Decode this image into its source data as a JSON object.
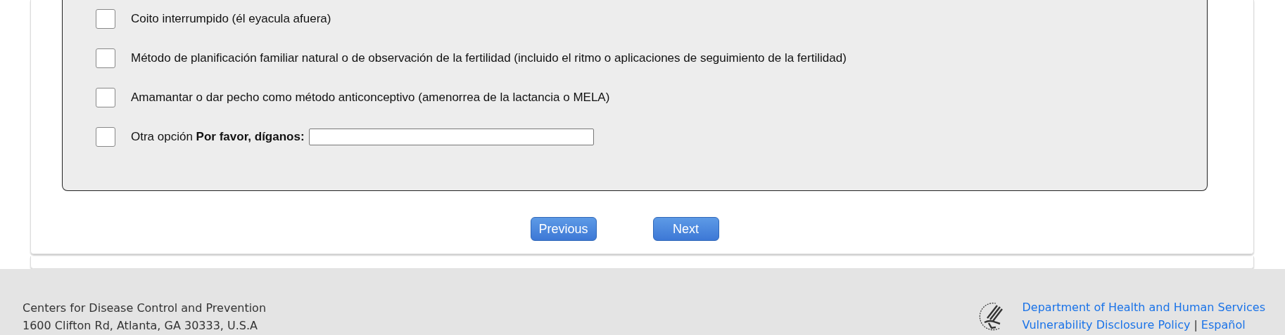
{
  "options": [
    {
      "label": "Coito interrumpido (él eyacula afuera)",
      "checked": false
    },
    {
      "label": "Método de planificación familiar natural o de observación de la fertilidad (incluido el ritmo o aplicaciones de seguimiento de la fertilidad)",
      "checked": false
    },
    {
      "label": "Amamantar o dar pecho como método anticonceptivo (amenorrea de la lactancia o MELA)",
      "checked": false
    },
    {
      "label": "Otra opción **Por favor, díganos:**",
      "checked": false,
      "kind": "other"
    }
  ],
  "buttons": [
    "Previous",
    "Next"
  ],
  "footer": {
    "org": "Centers for Disease Control and Prevention",
    "address": "1600 Clifton Rd, Atlanta, GA 30333, U.S.A",
    "links": [
      "Department of Health and Human Services",
      "Vulnerability Disclosure Policy",
      "Español"
    ],
    "separator": "|"
  }
}
